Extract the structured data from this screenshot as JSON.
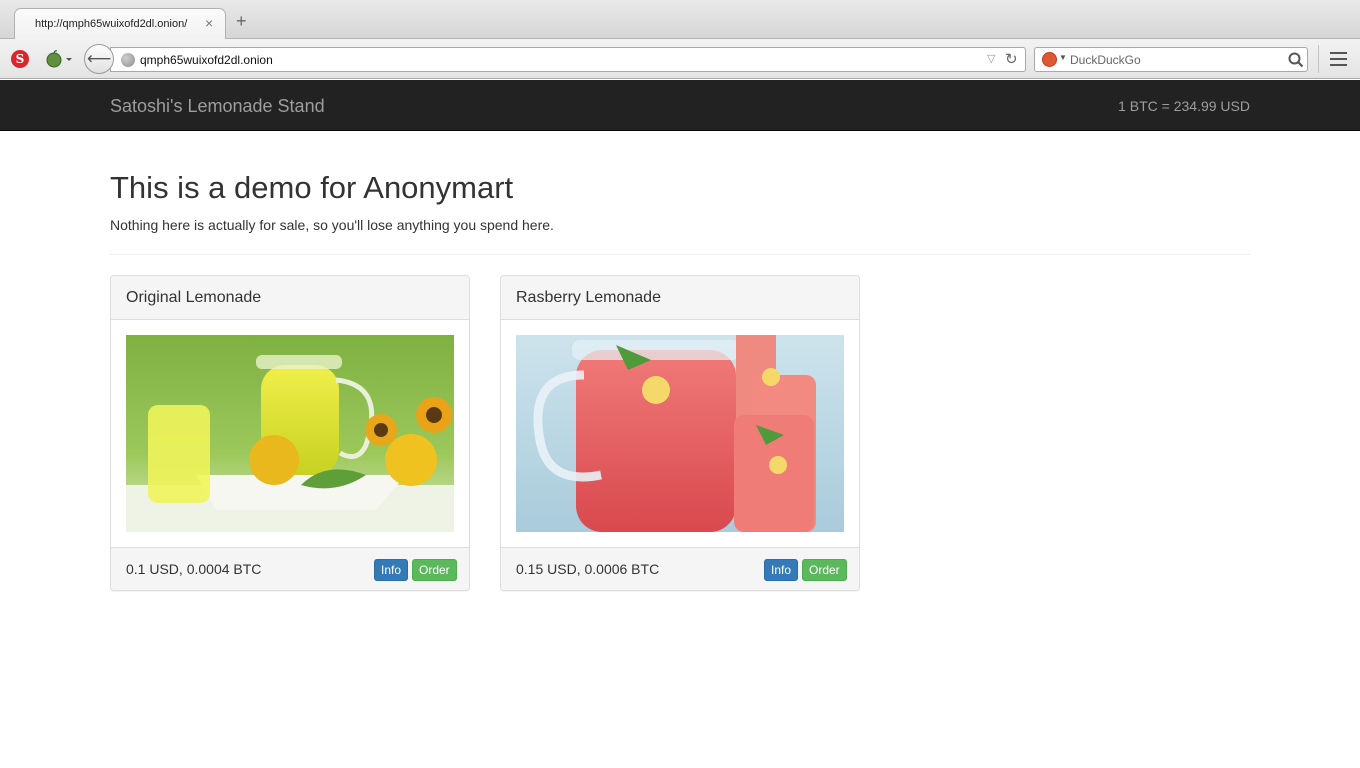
{
  "browser": {
    "tab_title": "http://qmph65wuixofd2dl.onion/",
    "tab_close": "×",
    "new_tab": "+",
    "back": "⟵",
    "url": "qmph65wuixofd2dl.onion",
    "search_placeholder": "DuckDuckGo",
    "url_dropdown": "▽",
    "reload": "↻",
    "ext_s_letter": "S"
  },
  "site": {
    "brand": "Satoshi's Lemonade Stand",
    "rate": "1 BTC = 234.99 USD"
  },
  "page": {
    "title": "This is a demo for Anonymart",
    "lead": "Nothing here is actually for sale, so you'll lose anything you spend here."
  },
  "products": [
    {
      "name": "Original Lemonade",
      "price": "0.1 USD, 0.0004 BTC",
      "info_label": "Info",
      "order_label": "Order"
    },
    {
      "name": "Rasberry Lemonade",
      "price": "0.15 USD, 0.0006 BTC",
      "info_label": "Info",
      "order_label": "Order"
    }
  ],
  "colors": {
    "navbar_bg": "#222222",
    "info_btn": "#337ab7",
    "order_btn": "#5cb85c"
  }
}
